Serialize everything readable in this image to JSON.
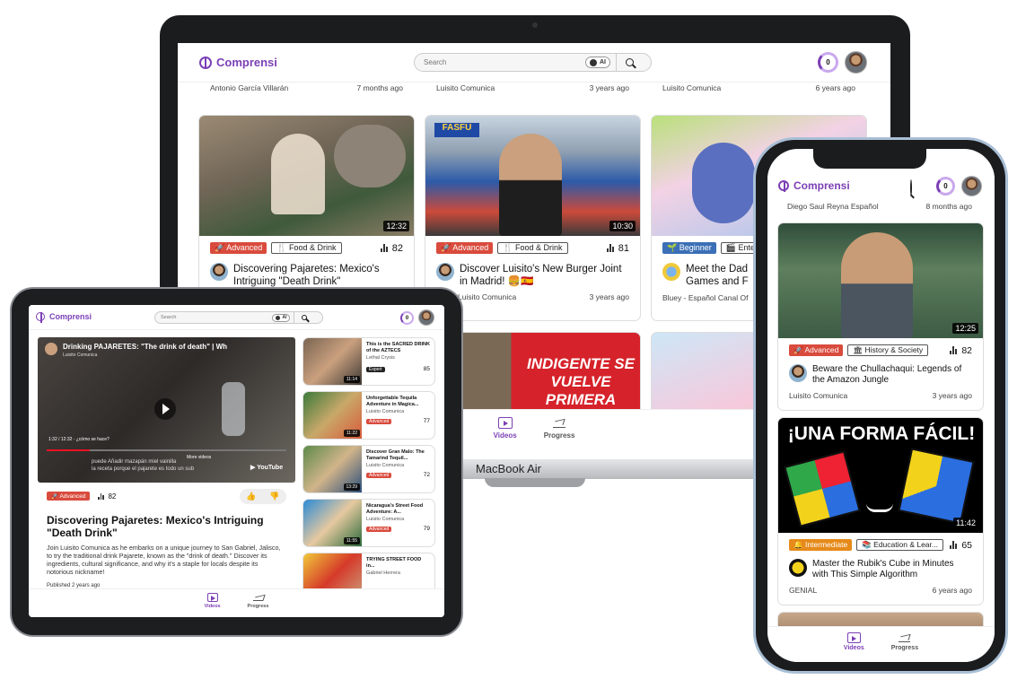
{
  "brand": {
    "name": "Comprensi",
    "accent": "#7b3fb5"
  },
  "search": {
    "placeholder": "Search",
    "ai_label": "AI"
  },
  "progress_count": "0",
  "nav": {
    "videos": "Videos",
    "progress": "Progress"
  },
  "laptop": {
    "device_label": "MacBook Air",
    "prev_row": [
      {
        "channel": "Antonio García Villarán",
        "age": "7 months ago"
      },
      {
        "channel": "Luisito Comunica",
        "age": "3 years ago"
      },
      {
        "channel": "Luisito Comunica",
        "age": "6 years ago"
      }
    ],
    "cards": [
      {
        "duration": "12:32",
        "level": "Advanced",
        "level_color": "#d94b3d",
        "topic": "Food & Drink",
        "views": "82",
        "title": "Discovering Pajaretes: Mexico's Intriguing \"Death Drink\"",
        "channel": "",
        "age": ""
      },
      {
        "duration": "10:30",
        "level": "Advanced",
        "level_color": "#d94b3d",
        "topic": "Food & Drink",
        "views": "81",
        "title": "Discover Luisito's New Burger Joint in Madrid! 🍔🇪🇸",
        "channel": "Luisito Comunica",
        "age": "3 years ago"
      },
      {
        "duration": "",
        "level": "Beginner",
        "level_color": "#3b6fb6",
        "topic": "Enter",
        "views": "",
        "title": "Meet the Dad Games and F",
        "channel": "Bluey - Español Canal Of",
        "age": ""
      }
    ],
    "next_row_text": "INDIGENTE SE VUELVE PRIMERA"
  },
  "tablet": {
    "player": {
      "title": "Drinking PAJARETES: \"The drink of death\" | Wh",
      "channel": "Luisito Comunica",
      "time": "1:32 / 12:32 · ¿cómo se hace?",
      "subtitle_line1": "puede Añadir mazapán miel vainilla",
      "subtitle_line2": "la receta porque el pajarete es todo un sub",
      "more_videos": "More videos",
      "youtube": "YouTube"
    },
    "level": "Advanced",
    "views": "82",
    "title": "Discovering Pajaretes: Mexico's Intriguing \"Death Drink\"",
    "description": "Join Luisito Comunica as he embarks on a unique journey to San Gabriel, Jalisco, to try the traditional drink Pajarete, known as the \"drink of death.\" Discover its ingredients, cultural significance, and why it's a staple for locals despite its notorious nickname!",
    "published": "Published 2 years ago",
    "sidebar": [
      {
        "title": "This is the SACRED DRINK of the AZTECS",
        "channel": "Lethal Crysis",
        "duration": "11:14",
        "level": "Expert",
        "level_color": "#222",
        "views": "85"
      },
      {
        "title": "Unforgettable Tequila Adventure in Magica...",
        "channel": "Luisito Comunica",
        "duration": "11:22",
        "level": "Advanced",
        "level_color": "#d94b3d",
        "views": "77"
      },
      {
        "title": "Discover Gran Malo: The Tamarind Tequil...",
        "channel": "Luisito Comunica",
        "duration": "13:29",
        "level": "Advanced",
        "level_color": "#d94b3d",
        "views": "72"
      },
      {
        "title": "Nicaragua's Street Food Adventure: A...",
        "channel": "Luisito Comunica",
        "duration": "11:55",
        "level": "Advanced",
        "level_color": "#d94b3d",
        "views": "79"
      },
      {
        "title": "TRYING STREET FOOD in...",
        "channel": "Gabriel Herrera",
        "duration": "",
        "level": "",
        "level_color": "#222",
        "views": ""
      }
    ]
  },
  "phone": {
    "prev": {
      "channel": "Diego Saul Reyna Español",
      "age": "8 months ago"
    },
    "cards": [
      {
        "duration": "12:25",
        "level": "Advanced",
        "level_color": "#d94b3d",
        "topic": "History & Society",
        "views": "82",
        "title": "Beware the Chullachaqui: Legends of the Amazon Jungle",
        "channel": "Luisito Comunica",
        "age": "3 years ago"
      },
      {
        "duration": "11:42",
        "level": "Intermediate",
        "level_color": "#e68a1a",
        "topic": "Education & Lear...",
        "views": "65",
        "title": "Master the Rubik's Cube in Minutes with This Simple Algorithm",
        "channel": "GENIAL",
        "age": "6 years ago",
        "thumb_text": "¡UNA FORMA FÁCIL!"
      }
    ]
  }
}
